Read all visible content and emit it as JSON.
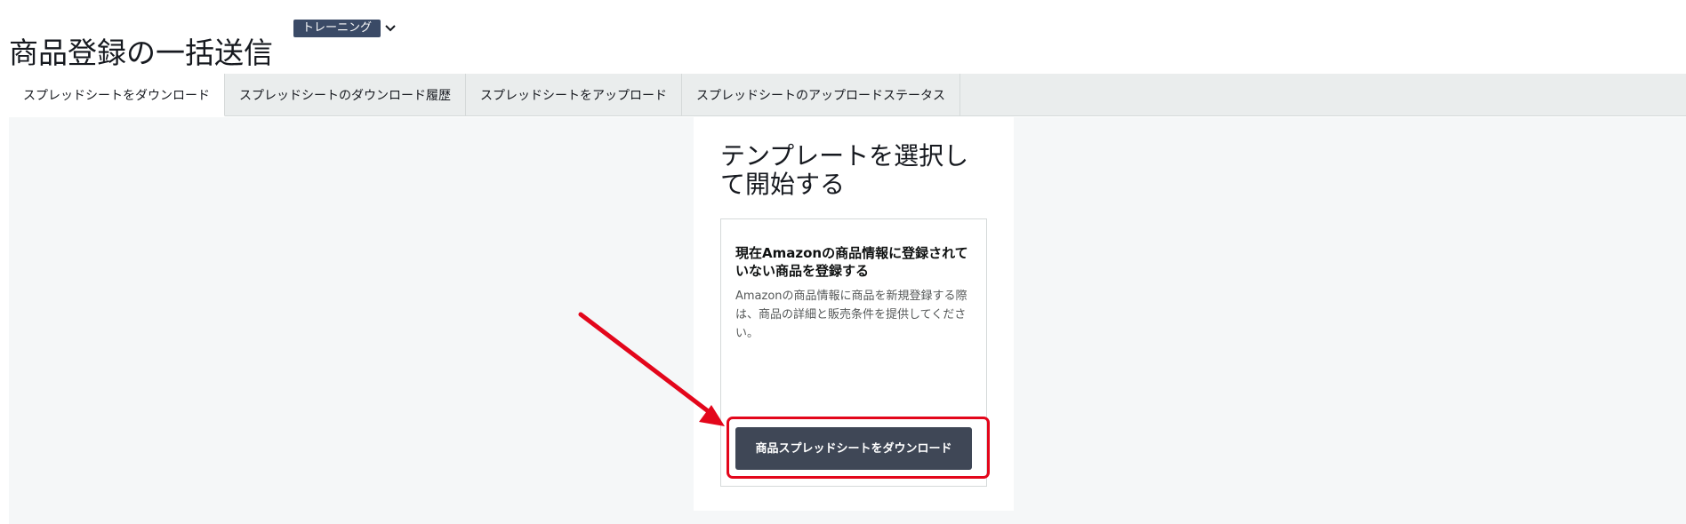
{
  "header": {
    "title": "商品登録の一括送信",
    "training_badge": "トレーニング",
    "training_icon": "chevron-down-icon"
  },
  "tabs": [
    {
      "label": "スプレッドシートをダウンロード",
      "active": true
    },
    {
      "label": "スプレッドシートのダウンロード履歴",
      "active": false
    },
    {
      "label": "スプレッドシートをアップロード",
      "active": false
    },
    {
      "label": "スプレッドシートのアップロードステータス",
      "active": false
    }
  ],
  "panel": {
    "heading": "テンプレートを選択して開始する",
    "card": {
      "title": "現在Amazonの商品情報に登録されていない商品を登録する",
      "description": "Amazonの商品情報に商品を新規登録する際は、商品の詳細と販売条件を提供してください。",
      "button_label": "商品スプレッドシートをダウンロード"
    }
  },
  "annotation": {
    "highlight_color": "#e3061b",
    "arrow_color": "#e3061b"
  },
  "colors": {
    "accent": "#008296",
    "button_bg": "#3f4756",
    "badge_bg": "#3a4a66"
  }
}
